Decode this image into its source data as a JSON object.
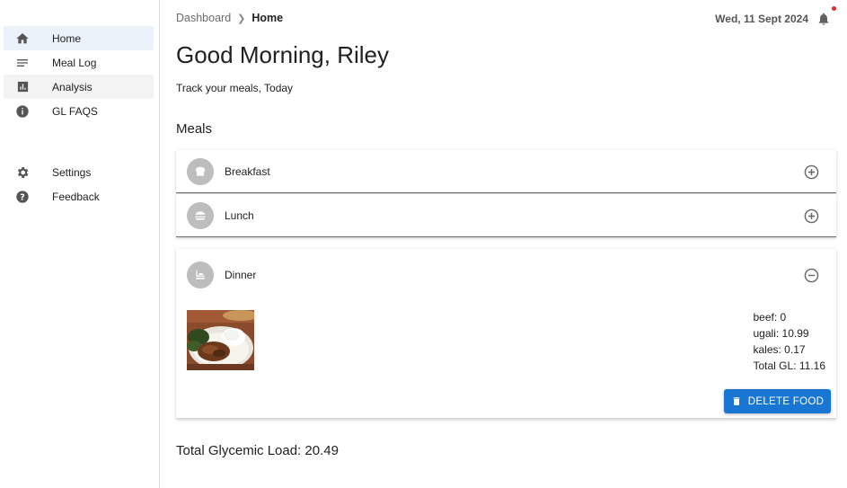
{
  "sidebar": {
    "items": [
      {
        "label": "Home",
        "icon": "home-icon"
      },
      {
        "label": "Meal Log",
        "icon": "list-icon"
      },
      {
        "label": "Analysis",
        "icon": "bar-chart-icon"
      },
      {
        "label": "GL FAQS",
        "icon": "info-icon"
      }
    ],
    "secondary": [
      {
        "label": "Settings",
        "icon": "gear-icon"
      },
      {
        "label": "Feedback",
        "icon": "help-icon"
      }
    ]
  },
  "header": {
    "breadcrumb_root": "Dashboard",
    "breadcrumb_current": "Home",
    "date": "Wed, 11 Sept 2024"
  },
  "main": {
    "greeting": "Good Morning, Riley",
    "subtitle": "Track your meals, Today",
    "section_title": "Meals",
    "meals": [
      {
        "label": "Breakfast",
        "expanded": false
      },
      {
        "label": "Lunch",
        "expanded": false
      },
      {
        "label": "Dinner",
        "expanded": true
      }
    ],
    "dinner_items": [
      "beef: 0",
      "ugali: 10.99",
      "kales: 0.17",
      "Total GL: 11.16"
    ],
    "delete_label": "DELETE FOOD",
    "total": "Total Glycemic Load: 20.49"
  },
  "colors": {
    "accent": "#1976d2",
    "active_nav": "#ecf2fa",
    "notification_dot": "#d32f2f"
  }
}
